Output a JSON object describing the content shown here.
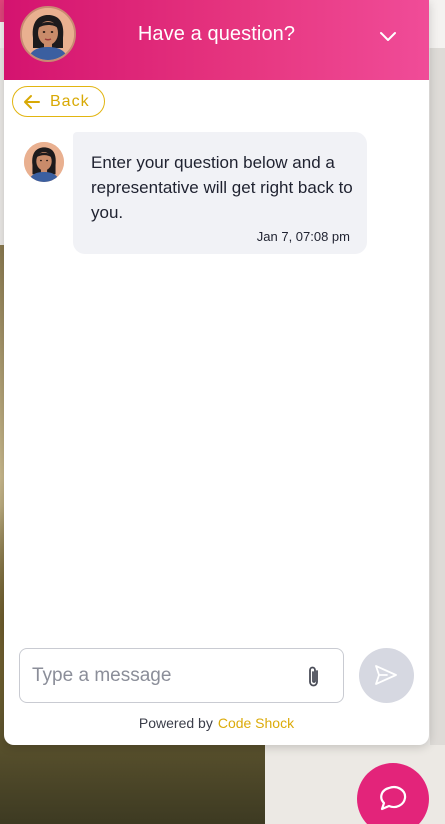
{
  "header": {
    "title": "Have a question?",
    "avatar_icon": "agent-avatar-icon",
    "collapse_icon": "chevron-down-icon"
  },
  "nav": {
    "back_label": "Back",
    "back_icon": "arrow-left-icon"
  },
  "messages": [
    {
      "sender_icon": "agent-avatar-icon",
      "text": "Enter your question below and a representative will get right back to you.",
      "time": "Jan 7, 07:08 pm"
    }
  ],
  "composer": {
    "placeholder": "Type a message",
    "value": "",
    "attach_icon": "paperclip-icon",
    "send_icon": "send-icon"
  },
  "footer": {
    "powered_by": "Powered by",
    "brand": "Code Shock"
  },
  "launcher": {
    "icon": "chat-bubble-icon"
  },
  "colors": {
    "header_start": "#d4136f",
    "header_end": "#f04c98",
    "accent_yellow": "#e2b511",
    "launcher": "#e3247a",
    "bubble_bg": "#f1f2f6"
  }
}
